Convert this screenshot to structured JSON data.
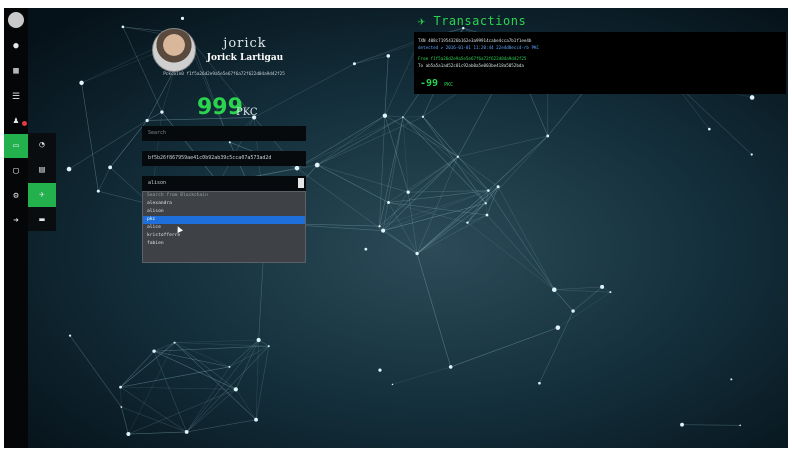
{
  "profile": {
    "nickname": "jorick",
    "full_name": "Jorick Lartigau",
    "address": "Pckcoin0 f1f5a26d2e9a5e5e67f6a72f622d04a9d42f25",
    "balance_value": "999",
    "balance_unit": "PKC"
  },
  "form": {
    "search_placeholder": "Search",
    "hash_value": "bf5b26f867959ae41c0b92ab39c5cca07a573ad2d",
    "recipient_selected": "alison",
    "dropdown_options": [
      {
        "label": "Search from Blockchain",
        "state": "header"
      },
      {
        "label": "alexandra",
        "state": "normal"
      },
      {
        "label": "alison",
        "state": "normal"
      },
      {
        "label": "pkc",
        "state": "highlighted"
      },
      {
        "label": "alice",
        "state": "normal"
      },
      {
        "label": "kristofferre",
        "state": "normal"
      },
      {
        "label": "fabien",
        "state": "normal"
      }
    ]
  },
  "transactions": {
    "title": "Transactions",
    "icon": "send-icon",
    "lines": [
      {
        "text": "TXN 408c71954326b162e3a99914cabe4cca7b1f1ee4b",
        "color": "#d8e0e3"
      },
      {
        "text": "detected ✔ 2016-01-01 11:20:44 22e4d8ecc4-rb PKC",
        "color": "#5aa8ff"
      },
      {
        "text": "From f1f5a26d2e9a5e5e67f6a72f622d04a9d42f25",
        "color": "#2bd44f"
      },
      {
        "text": "To ab5a5a1ad52c01c92ab0a5e003be418a5052bda",
        "color": "#d8e0e3"
      }
    ],
    "amount": "-99",
    "amount_unit": "PKC"
  },
  "sidebar": {
    "items": [
      {
        "icon": "avatar-icon",
        "glyph": "☻"
      },
      {
        "icon": "globe-icon",
        "glyph": "●"
      },
      {
        "icon": "grid-icon",
        "glyph": "▦"
      },
      {
        "icon": "chat-icon",
        "glyph": "☰"
      },
      {
        "icon": "users-icon",
        "glyph": "♟"
      },
      {
        "icon": "wallet-icon",
        "glyph": "▭"
      },
      {
        "icon": "folder-icon",
        "glyph": "▢"
      },
      {
        "icon": "settings-icon",
        "glyph": "⚙"
      },
      {
        "icon": "logout-icon",
        "glyph": "➜"
      }
    ],
    "sub_items": [
      {
        "icon": "dashboard-icon",
        "glyph": "◔"
      },
      {
        "icon": "card-icon",
        "glyph": "▤"
      },
      {
        "icon": "send-icon",
        "glyph": "✈"
      },
      {
        "icon": "folder-open-icon",
        "glyph": "▬"
      }
    ],
    "accent_color": "#22b14c",
    "notification_color": "#e63946"
  }
}
